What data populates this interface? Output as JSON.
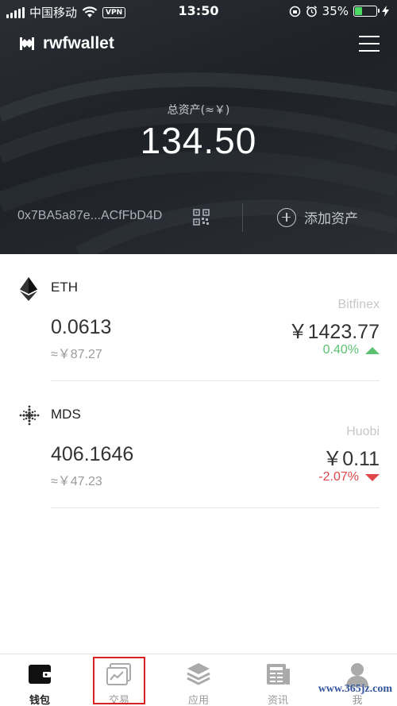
{
  "status_bar": {
    "carrier": "中国移动",
    "vpn": "VPN",
    "time": "13:50",
    "battery": "35%",
    "battery_level": 0.35
  },
  "header": {
    "title": "rwfwallet"
  },
  "summary": {
    "total_label": "总资产(≈￥)",
    "total_value": "134.50",
    "address": "0x7BA5a87e...ACfFbD4D",
    "add_asset_label": "添加资产"
  },
  "assets": [
    {
      "symbol": "ETH",
      "exchange": "Bitfinex",
      "balance": "0.0613",
      "cny_value": "≈￥87.27",
      "price": "￥1423.77",
      "change": "0.40%",
      "change_direction": "up",
      "change_color": "#5cc272",
      "icon": "ethereum-icon"
    },
    {
      "symbol": "MDS",
      "exchange": "Huobi",
      "balance": "406.1646",
      "cny_value": "≈￥47.23",
      "price": "￥0.11",
      "change": "-2.07%",
      "change_direction": "down",
      "change_color": "#e0464a",
      "icon": "mds-dots-icon"
    }
  ],
  "tabbar": {
    "tabs": [
      {
        "label": "钱包",
        "icon": "wallet-icon",
        "active": true
      },
      {
        "label": "交易",
        "icon": "trade-chart-icon",
        "active": false
      },
      {
        "label": "应用",
        "icon": "layers-icon",
        "active": false
      },
      {
        "label": "资讯",
        "icon": "news-icon",
        "active": false
      },
      {
        "label": "我",
        "icon": "person-icon",
        "active": false
      }
    ]
  },
  "watermark": "www.365jz.com",
  "colors": {
    "header_bg": "#22262b",
    "positive": "#5cc272",
    "negative": "#e0464a",
    "highlight": "#e02020"
  }
}
